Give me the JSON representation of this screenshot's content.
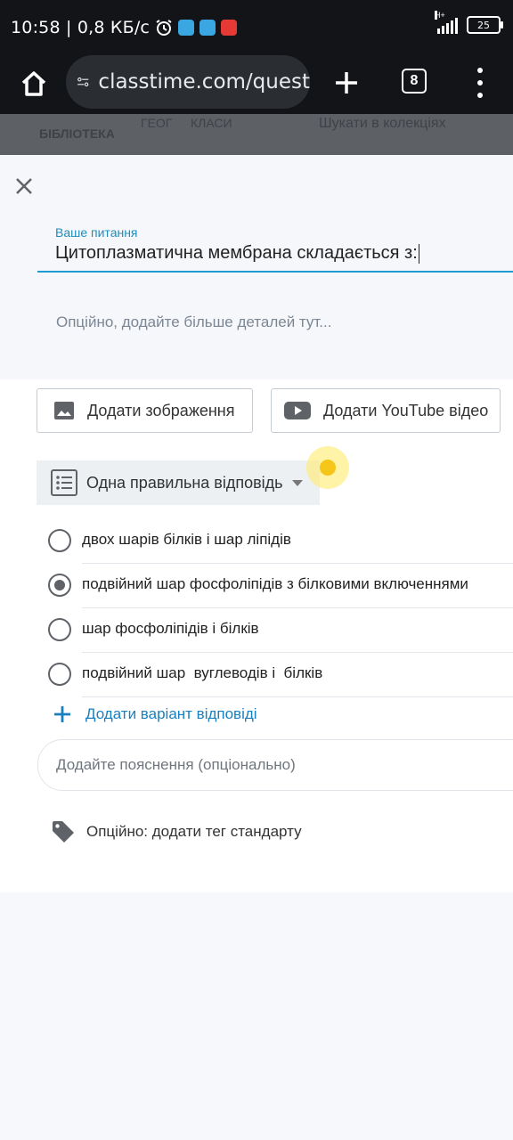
{
  "status_bar": {
    "time_speed": "10:58 | 0,8 КБ/с",
    "network": "H+",
    "battery": "25"
  },
  "browser": {
    "url": "classtime.com/quest",
    "tabs_count": "8"
  },
  "background_header": {
    "library": "БІБЛІОТЕКА",
    "geo": "ГЕОГ",
    "classes": "КЛАСИ",
    "search": "Шукати в колекціях"
  },
  "question": {
    "label": "Ваше питання",
    "value": "Цитоплазматична мембрана складається з:",
    "details_placeholder": "Опційно, додайте більше деталей тут..."
  },
  "media": {
    "add_image": "Додати зображення",
    "add_youtube": "Додати YouTube відео"
  },
  "question_type": {
    "selected": "Одна правильна відповідь"
  },
  "answers": [
    {
      "text": "двох шарів білків і шар ліпідів",
      "checked": false
    },
    {
      "text": "подвійний шар фосфоліпідів з білковими включеннями",
      "checked": true
    },
    {
      "text": "шар фосфоліпідів і білків",
      "checked": false
    },
    {
      "text": "подвійний шар  вуглеводів і  білків",
      "checked": false
    }
  ],
  "add_answer": "Додати варіант відповіді",
  "explanation_placeholder": "Додайте пояснення (опціонально)",
  "standard_tag": "Опційно: додати тег стандарту",
  "colors": {
    "accent": "#1f9bd1",
    "link": "#1a7fbf",
    "status_bg": "#121417"
  }
}
